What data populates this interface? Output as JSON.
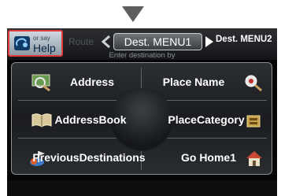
{
  "tabs": {
    "route": "Route",
    "dest1": "Dest. MENU1",
    "dest2": "Dest. MENU2"
  },
  "help_button": {
    "or_say": "or say",
    "label": "Help",
    "highlight_color": "#e23b3b"
  },
  "subtitle": "Enter destination by",
  "menu": {
    "address": "Address",
    "place_name": "Place Name",
    "address_book": [
      "Address",
      "Book"
    ],
    "place_category": [
      "Place",
      "Category"
    ],
    "previous_destinations": [
      "Previous",
      "Destinations"
    ],
    "go_home": "Go Home1"
  },
  "icons": {
    "address": "magnifier-map-icon",
    "place_name": "magnifier-pin-icon",
    "address_book": "open-book-icon",
    "place_category": "category-box-icon",
    "previous_destinations": "history-flag-icon",
    "go_home": "house-icon",
    "help": "help-icon",
    "pointer": "down-triangle-icon"
  }
}
